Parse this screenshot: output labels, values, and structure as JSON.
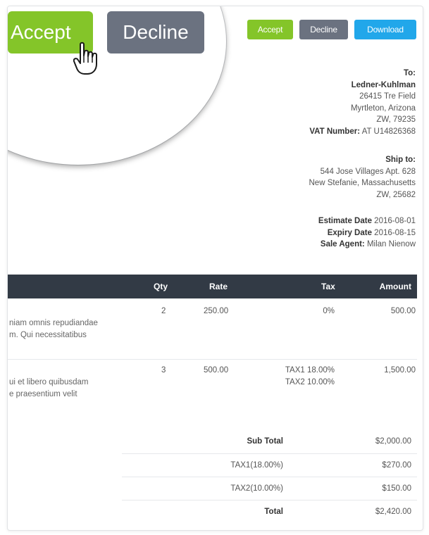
{
  "actions": {
    "accept": "Accept",
    "decline": "Decline",
    "download": "Download"
  },
  "magnified": {
    "accept": "Accept",
    "decline": "Decline"
  },
  "to": {
    "heading": "To:",
    "company": "Ledner-Kuhlman",
    "street": "26415 Tre Field",
    "city_state": "Myrtleton, Arizona",
    "zip": "ZW, 79235",
    "vat_label": "VAT Number:",
    "vat_value": "AT U14826368"
  },
  "ship_to": {
    "heading": "Ship to:",
    "street": "544 Jose Villages Apt. 628",
    "city_state": "New Stefanie, Massachusetts",
    "zip": "ZW, 25682"
  },
  "dates": {
    "estimate_label": "Estimate Date",
    "estimate_value": "2016-08-01",
    "expiry_label": "Expiry Date",
    "expiry_value": "2016-08-15",
    "agent_label": "Sale Agent:",
    "agent_value": "Milan Nienow"
  },
  "table": {
    "headers": {
      "qty": "Qty",
      "rate": "Rate",
      "tax": "Tax",
      "amount": "Amount"
    },
    "rows": [
      {
        "desc_line1": "niam omnis repudiandae",
        "desc_line2": "m. Qui necessitatibus",
        "qty": "2",
        "rate": "250.00",
        "tax_line1": "0%",
        "tax_line2": "",
        "amount": "500.00"
      },
      {
        "desc_line1": "ui et libero quibusdam",
        "desc_line2": "e praesentium velit",
        "qty": "3",
        "rate": "500.00",
        "tax_line1": "TAX1 18.00%",
        "tax_line2": "TAX2 10.00%",
        "amount": "1,500.00"
      }
    ]
  },
  "totals": {
    "subtotal_label": "Sub Total",
    "subtotal_value": "$2,000.00",
    "tax1_label": "TAX1(18.00%)",
    "tax1_value": "$270.00",
    "tax2_label": "TAX2(10.00%)",
    "tax2_value": "$150.00",
    "total_label": "Total",
    "total_value": "$2,420.00"
  },
  "colors": {
    "accept": "#84c529",
    "decline": "#6b7280",
    "download": "#21a7ea",
    "table_header": "#323a45"
  }
}
